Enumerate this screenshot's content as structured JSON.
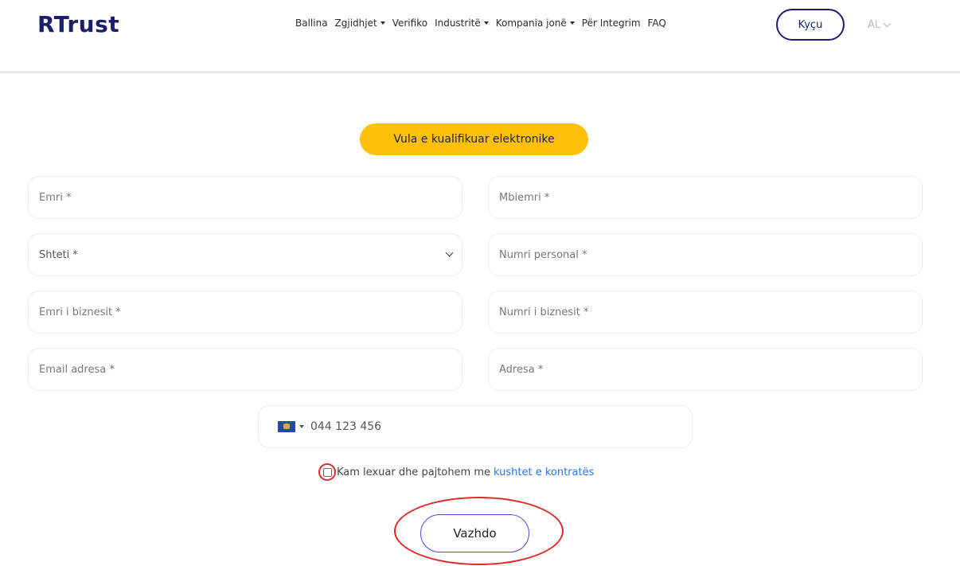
{
  "header": {
    "logo": "RTrust",
    "nav": [
      {
        "label": "Ballina",
        "dropdown": false
      },
      {
        "label": "Zgjidhjet",
        "dropdown": true
      },
      {
        "label": "Verifiko",
        "dropdown": false
      },
      {
        "label": "Industritë",
        "dropdown": true
      },
      {
        "label": "Kompania jonë",
        "dropdown": true
      },
      {
        "label": "Për Integrim",
        "dropdown": false
      },
      {
        "label": "FAQ",
        "dropdown": false
      }
    ],
    "login_label": "Kyçu",
    "language": "AL"
  },
  "form": {
    "badge": "Vula e kualifikuar elektronike",
    "first_name": "Emri *",
    "last_name": "Mbiemri *",
    "country": "Shteti *",
    "personal_number": "Numri personal *",
    "business_name": "Emri i biznesit *",
    "business_number": "Numri i biznesit *",
    "email": "Email adresa *",
    "address": "Adresa *",
    "phone_placeholder": "044 123 456",
    "agree_text": "Kam lexuar dhe pajtohem me",
    "agree_link": "kushtet e kontratës",
    "submit_label": "Vazhdo"
  },
  "colors": {
    "brand": "#1d1d6f",
    "badge": "#ffc107",
    "link": "#2b78e4",
    "highlight": "#e02828"
  }
}
